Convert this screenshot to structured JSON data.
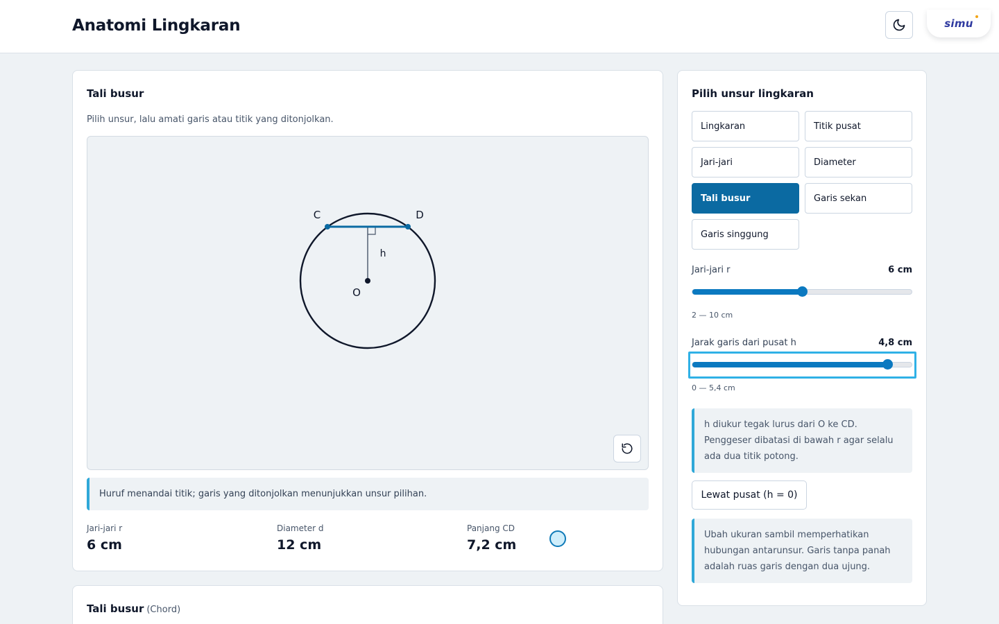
{
  "header": {
    "title": "Anatomi Lingkaran",
    "theme_icon": "moon-icon",
    "logo_text": "simu"
  },
  "main": {
    "title": "Tali busur",
    "subtitle": "Pilih unsur, lalu amati garis atau titik yang ditonjolkan.",
    "diagram": {
      "labels": {
        "c": "C",
        "d": "D",
        "h": "h",
        "o": "O"
      },
      "radius_cm": 6,
      "distance_h_cm": 4.8
    },
    "reset_icon": "rotate-ccw-icon",
    "hint": "Huruf menandai titik; garis yang ditonjolkan menunjukkan unsur pilihan.",
    "stats": [
      {
        "label": "Jari-jari r",
        "value": "6 cm"
      },
      {
        "label": "Diameter d",
        "value": "12 cm"
      },
      {
        "label": "Panjang CD",
        "value": "7,2 cm"
      }
    ]
  },
  "bottom": {
    "title": "Tali busur",
    "muted": "(Chord)"
  },
  "side": {
    "title": "Pilih unsur lingkaran",
    "elements": [
      {
        "label": "Lingkaran",
        "active": false
      },
      {
        "label": "Titik pusat",
        "active": false
      },
      {
        "label": "Jari-jari",
        "active": false
      },
      {
        "label": "Diameter",
        "active": false
      },
      {
        "label": "Tali busur",
        "active": true
      },
      {
        "label": "Garis sekan",
        "active": false
      },
      {
        "label": "Garis singgung",
        "active": false
      }
    ],
    "radius_slider": {
      "label": "Jari-jari r",
      "value_text": "6 cm",
      "range_text": "2 — 10 cm",
      "fraction": 0.5
    },
    "distance_slider": {
      "label": "Jarak garis dari pusat h",
      "value_text": "4,8 cm",
      "range_text": "0 — 5,4 cm",
      "fraction": 0.889
    },
    "note1": "h diukur tegak lurus dari O ke CD. Penggeser dibatasi di bawah r agar selalu ada dua titik potong.",
    "pass_button": "Lewat pusat (h = 0)",
    "note2": "Ubah ukuran sambil memperhatikan hubungan antarunsur. Garis tanpa panah adalah ruas garis dengan dua ujung."
  },
  "colors": {
    "accent": "#0b6aa2",
    "slider": "#0b79c0",
    "focus": "#2fb1e6",
    "background": "#eef2f5"
  }
}
